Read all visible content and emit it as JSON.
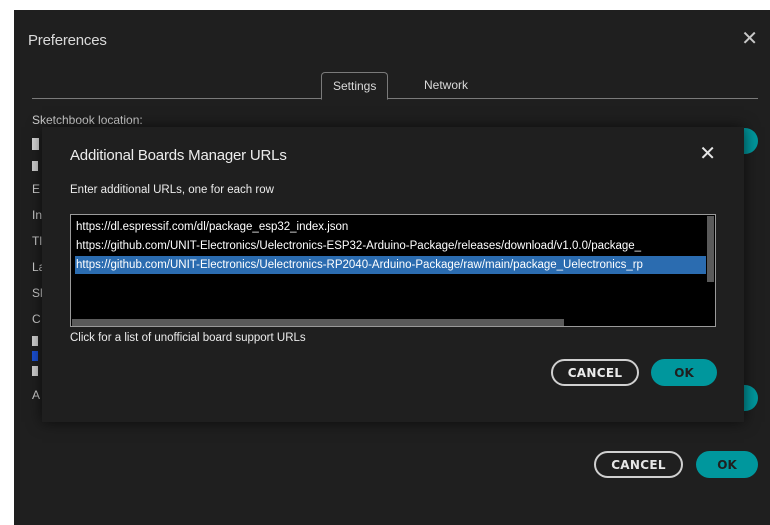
{
  "preferences": {
    "title": "Preferences",
    "close_icon": "✕",
    "tabs": [
      {
        "label": "Settings",
        "active": true
      },
      {
        "label": "Network",
        "active": false
      }
    ],
    "sketchbook_label": "Sketchbook location:",
    "background_letters": [
      "E",
      "In",
      "Tl",
      "La",
      "Sl",
      "C",
      "A"
    ],
    "cancel_label": "CANCEL",
    "ok_label": "OK"
  },
  "dialog": {
    "title": "Additional Boards Manager URLs",
    "close_icon": "✕",
    "instruction": "Enter additional URLs, one for each row",
    "urls": [
      "https://dl.espressif.com/dl/package_esp32_index.json",
      "https://github.com/UNIT-Electronics/Uelectronics-ESP32-Arduino-Package/releases/download/v1.0.0/package_",
      "https://github.com/UNIT-Electronics/Uelectronics-RP2040-Arduino-Package/raw/main/package_Uelectronics_rp"
    ],
    "link_text": "Click for a list of unofficial board support URLs",
    "cancel_label": "CANCEL",
    "ok_label": "OK"
  },
  "colors": {
    "background": "#1f1f1f",
    "accent": "#00979d",
    "selection": "#2b6cb0"
  }
}
